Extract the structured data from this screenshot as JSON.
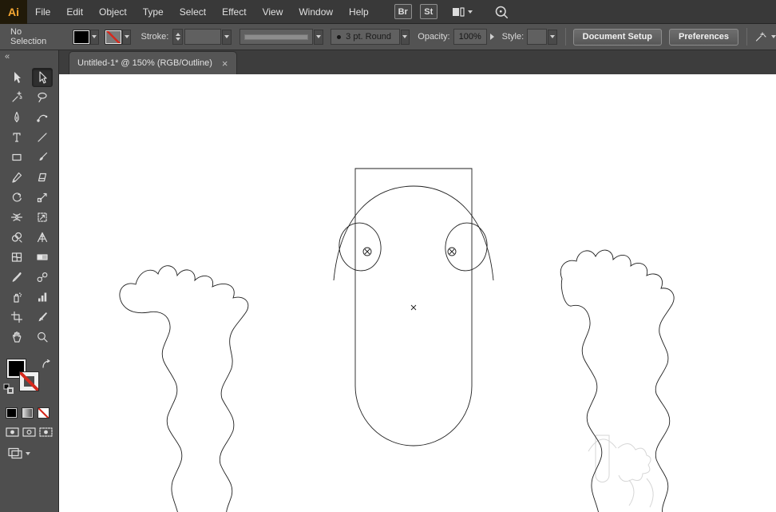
{
  "app": {
    "logo_text": "Ai"
  },
  "menubar": {
    "items": [
      "File",
      "Edit",
      "Object",
      "Type",
      "Select",
      "Effect",
      "View",
      "Window",
      "Help"
    ]
  },
  "appbar": {
    "bridge_label": "Br",
    "stock_label": "St"
  },
  "control_bar": {
    "selection_status": "No Selection",
    "stroke_label": "Stroke:",
    "brush_bullet": "•",
    "brush_value": "3 pt. Round",
    "opacity_label": "Opacity:",
    "opacity_value": "100%",
    "style_label": "Style:",
    "document_setup_label": "Document Setup",
    "preferences_label": "Preferences"
  },
  "document_tab": {
    "title": "Untitled-1* @ 150% (RGB/Outline)",
    "close_glyph": "×"
  },
  "toolbar": {
    "collapse_glyph": "«",
    "selected_tool": "direct-selection",
    "tools": [
      "selection",
      "direct-selection",
      "magic-wand",
      "lasso",
      "pen",
      "curvature",
      "type",
      "line-segment",
      "rectangle",
      "paintbrush",
      "pencil",
      "eraser",
      "rotate",
      "scale",
      "width",
      "free-transform",
      "shape-builder",
      "perspective-grid",
      "mesh",
      "gradient",
      "eyedropper",
      "blend",
      "symbol-sprayer",
      "column-graph",
      "artboard",
      "slice",
      "hand",
      "zoom"
    ]
  },
  "colors": {
    "chrome_dark": "#393939",
    "chrome_mid": "#535353",
    "accent_red": "#d42a1e",
    "canvas": "#ffffff",
    "logo_orange": "#f7a832"
  }
}
